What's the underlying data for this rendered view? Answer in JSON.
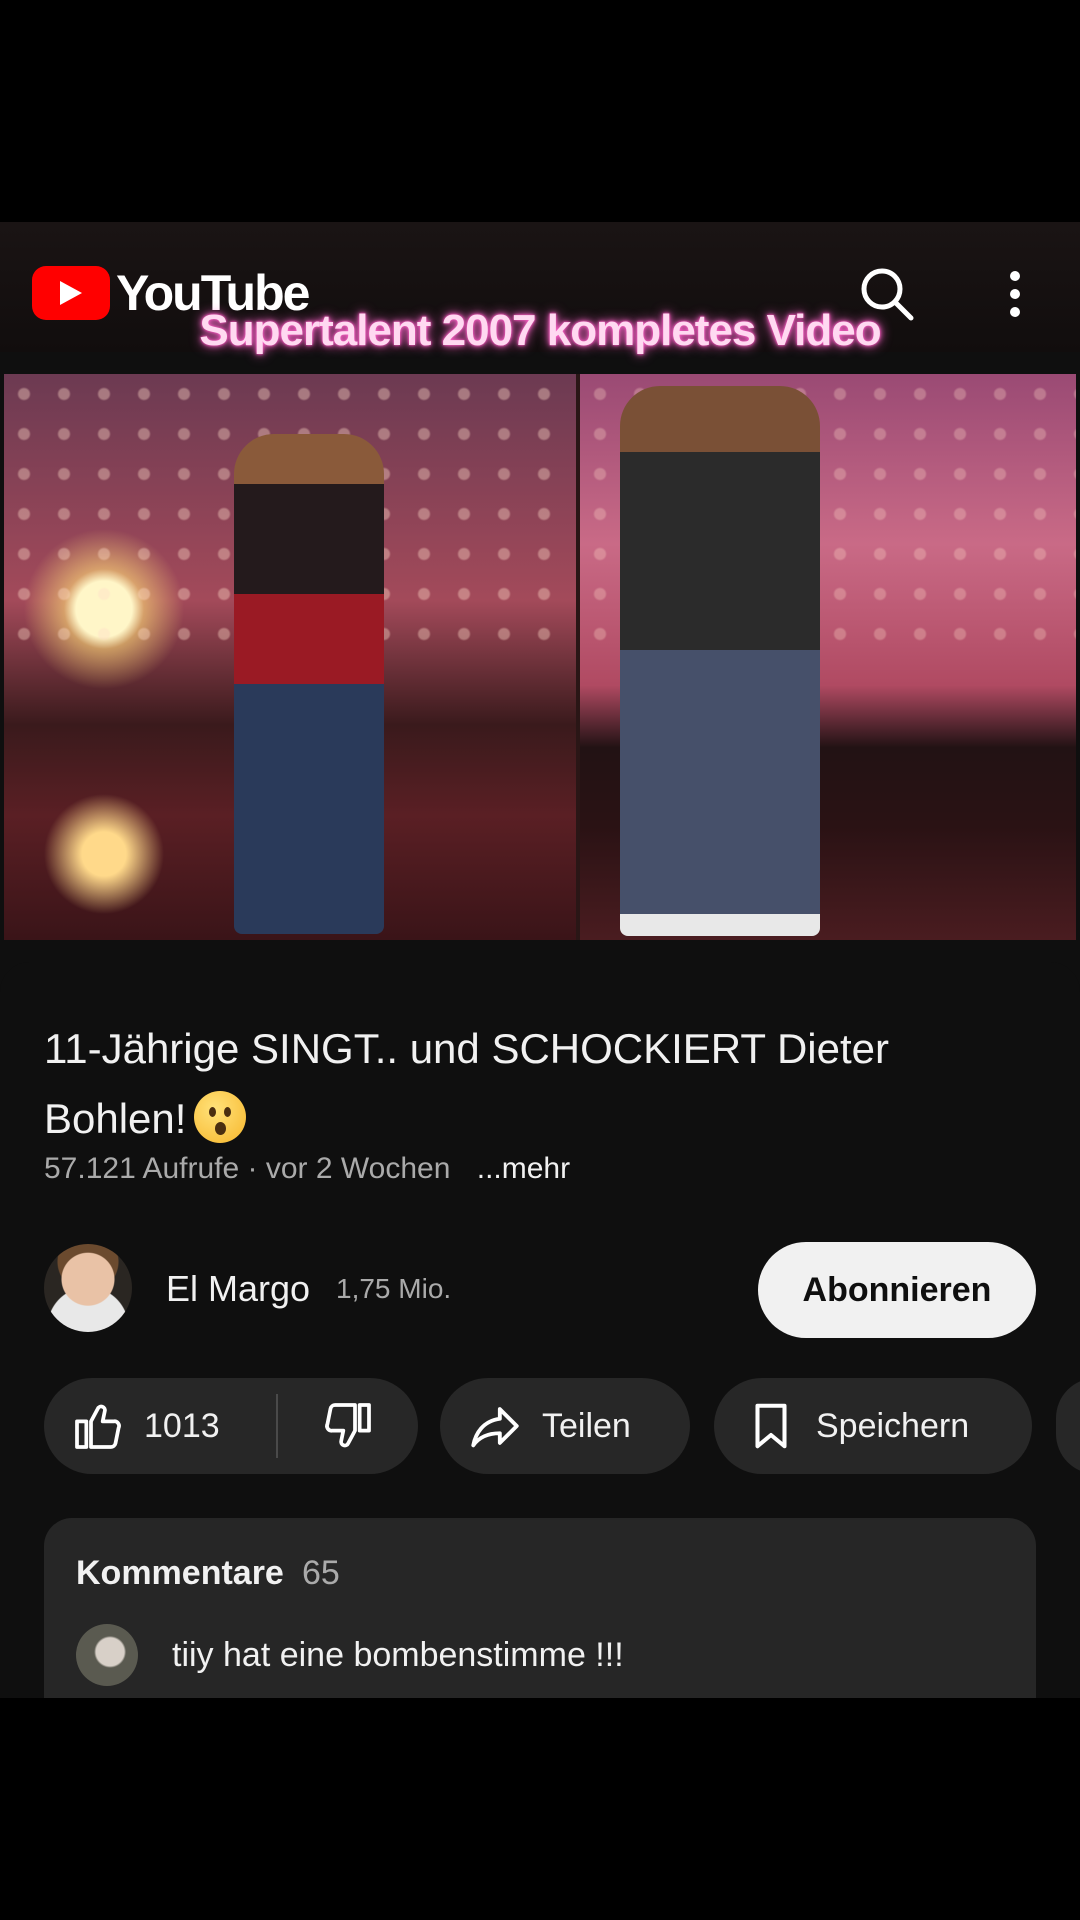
{
  "app": {
    "logo_text": "YouTube",
    "overlay_caption": "Supertalent 2007 kompletes Video"
  },
  "icons": {
    "logo": "youtube-play-icon",
    "search": "search-icon",
    "more": "more-vert-icon",
    "like": "thumbs-up-icon",
    "dislike": "thumbs-down-icon",
    "share": "share-arrow-icon",
    "save": "bookmark-icon"
  },
  "video": {
    "title": "11-Jährige SINGT.. und SCHOCKIERT Dieter Bohlen!",
    "emoji": "astonished-face",
    "views": "57.121 Aufrufe",
    "separator": "·",
    "age": "vor 2 Wochen",
    "more_label": "...mehr"
  },
  "channel": {
    "name": "El Margo",
    "subscribers": "1,75 Mio.",
    "subscribe_label": "Abonnieren"
  },
  "actions": {
    "likes": "1013",
    "share_label": "Teilen",
    "save_label": "Speichern"
  },
  "comments": {
    "header": "Kommentare",
    "count": "65",
    "first_comment": "tiiy hat eine bombenstimme !!!"
  },
  "colors": {
    "background": "#0f0f0f",
    "brand_red": "#ff0000",
    "pill": "#272727",
    "overlay_glow": "#ff66cc"
  }
}
